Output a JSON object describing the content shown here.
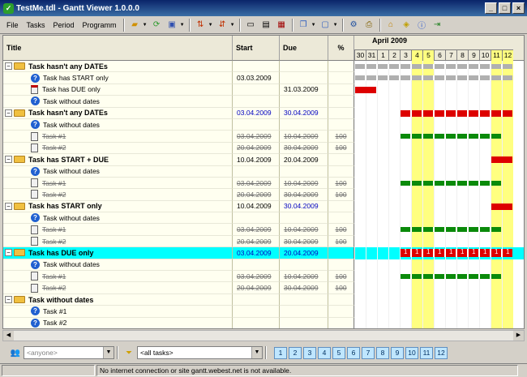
{
  "window": {
    "title": "TestMe.tdl - Gantt Viewer 1.0.0.0"
  },
  "menu": [
    "File",
    "Tasks",
    "Period",
    "Programm"
  ],
  "columns": {
    "title": "Title",
    "start": "Start",
    "due": "Due",
    "percent": "%"
  },
  "timeline": {
    "month": "April 2009",
    "days": [
      "30",
      "31",
      "1",
      "2",
      "3",
      "4",
      "5",
      "6",
      "7",
      "8",
      "9",
      "10",
      "11",
      "12"
    ],
    "weekend": [
      false,
      false,
      false,
      false,
      false,
      true,
      true,
      false,
      false,
      false,
      false,
      false,
      true,
      true
    ]
  },
  "rows": [
    {
      "level": 0,
      "kind": "group",
      "title": "Task hasn't any DATEs",
      "start": "",
      "due": "",
      "pct": "",
      "bars": [
        {
          "s": 0,
          "e": 14,
          "c": "gray"
        }
      ]
    },
    {
      "level": 1,
      "kind": "q",
      "title": "Task has START only",
      "start": "03.03.2009",
      "due": "",
      "pct": "",
      "bars": [
        {
          "s": 0,
          "e": 14,
          "c": "gray"
        }
      ]
    },
    {
      "level": 1,
      "kind": "redoc",
      "title": "Task has DUE only",
      "start": "",
      "due": "31.03.2009",
      "pct": "",
      "bars": [
        {
          "s": 0,
          "e": 2,
          "c": "red"
        }
      ]
    },
    {
      "level": 1,
      "kind": "q",
      "title": "Task without dates",
      "start": "",
      "due": "",
      "pct": "",
      "bars": []
    },
    {
      "level": 0,
      "kind": "group",
      "title": "Task hasn't any DATEs",
      "start": "03.04.2009",
      "due": "30.04.2009",
      "pct": "",
      "blue": true,
      "bars": [
        {
          "s": 4,
          "e": 14,
          "c": "red"
        }
      ]
    },
    {
      "level": 1,
      "kind": "q",
      "title": "Task without dates",
      "start": "",
      "due": "",
      "pct": "",
      "bars": []
    },
    {
      "level": 1,
      "kind": "doc",
      "title": "Task #1",
      "start": "03.04.2009",
      "due": "10.04.2009",
      "pct": "100",
      "done": true,
      "bars": [
        {
          "s": 4,
          "e": 13,
          "c": "green"
        }
      ]
    },
    {
      "level": 1,
      "kind": "doc",
      "title": "Task #2",
      "start": "20.04.2009",
      "due": "30.04.2009",
      "pct": "100",
      "done": true,
      "bars": []
    },
    {
      "level": 0,
      "kind": "group",
      "title": "Task has START + DUE",
      "start": "10.04.2009",
      "due": "20.04.2009",
      "pct": "",
      "bars": [
        {
          "s": 12,
          "e": 14,
          "c": "red"
        }
      ]
    },
    {
      "level": 1,
      "kind": "q",
      "title": "Task without dates",
      "start": "",
      "due": "",
      "pct": "",
      "bars": []
    },
    {
      "level": 1,
      "kind": "doc",
      "title": "Task #1",
      "start": "03.04.2009",
      "due": "10.04.2009",
      "pct": "100",
      "done": true,
      "bars": [
        {
          "s": 4,
          "e": 13,
          "c": "green"
        }
      ]
    },
    {
      "level": 1,
      "kind": "doc",
      "title": "Task #2",
      "start": "20.04.2009",
      "due": "30.04.2009",
      "pct": "100",
      "done": true,
      "bars": []
    },
    {
      "level": 0,
      "kind": "group",
      "title": "Task has START only",
      "start": "10.04.2009",
      "due": "30.04.2009",
      "pct": "",
      "dueblue": true,
      "bars": [
        {
          "s": 12,
          "e": 14,
          "c": "red"
        }
      ]
    },
    {
      "level": 1,
      "kind": "q",
      "title": "Task without dates",
      "start": "",
      "due": "",
      "pct": "",
      "bars": []
    },
    {
      "level": 1,
      "kind": "doc",
      "title": "Task #1",
      "start": "03.04.2009",
      "due": "10.04.2009",
      "pct": "100",
      "done": true,
      "bars": [
        {
          "s": 4,
          "e": 13,
          "c": "green"
        }
      ]
    },
    {
      "level": 1,
      "kind": "doc",
      "title": "Task #2",
      "start": "20.04.2009",
      "due": "30.04.2009",
      "pct": "100",
      "done": true,
      "bars": []
    },
    {
      "level": 0,
      "kind": "group",
      "title": "Task has  DUE only",
      "start": "03.04.2009",
      "due": "20.04.2009",
      "pct": "",
      "blue": true,
      "selected": true,
      "bars": [
        {
          "s": 4,
          "e": 14,
          "c": "red",
          "labels": "1"
        }
      ]
    },
    {
      "level": 1,
      "kind": "q",
      "title": "Task without dates",
      "start": "",
      "due": "",
      "pct": "",
      "bars": []
    },
    {
      "level": 1,
      "kind": "doc",
      "title": "Task #1",
      "start": "03.04.2009",
      "due": "10.04.2009",
      "pct": "100",
      "done": true,
      "bars": [
        {
          "s": 4,
          "e": 13,
          "c": "green"
        }
      ]
    },
    {
      "level": 1,
      "kind": "doc",
      "title": "Task #2",
      "start": "20.04.2009",
      "due": "30.04.2009",
      "pct": "100",
      "done": true,
      "bars": []
    },
    {
      "level": 0,
      "kind": "group",
      "title": "Task without dates",
      "start": "",
      "due": "",
      "pct": "",
      "bars": []
    },
    {
      "level": 1,
      "kind": "q",
      "title": "Task #1",
      "start": "",
      "due": "",
      "pct": "",
      "bars": []
    },
    {
      "level": 1,
      "kind": "q",
      "title": "Task #2",
      "start": "",
      "due": "",
      "pct": "",
      "bars": []
    }
  ],
  "filters": {
    "person": "<anyone>",
    "tasks": "<all tasks>"
  },
  "periods": [
    "1",
    "2",
    "3",
    "4",
    "5",
    "6",
    "7",
    "8",
    "9",
    "10",
    "11",
    "12"
  ],
  "status": {
    "message": "No internet connection or site gantt.webest.net is not available."
  }
}
